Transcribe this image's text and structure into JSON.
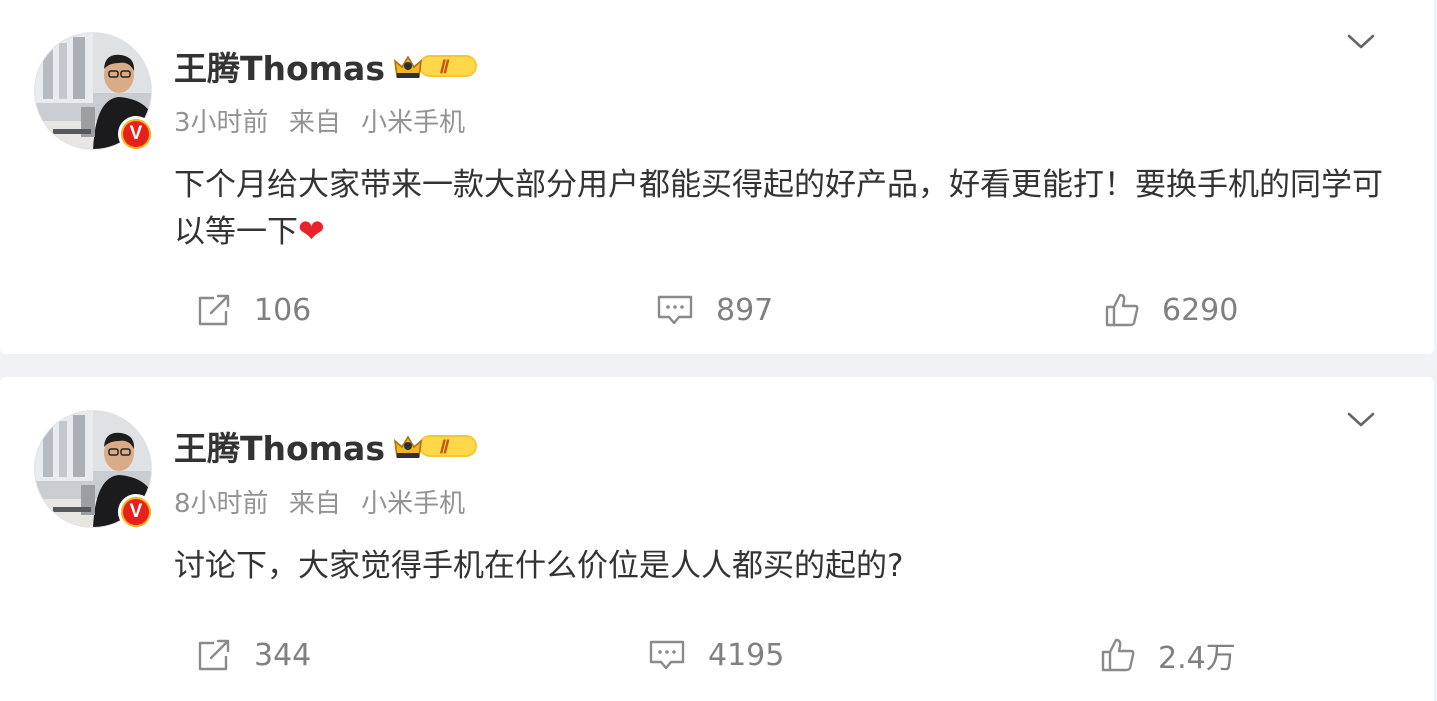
{
  "colors": {
    "background": "#f1f2f5",
    "card": "#ffffff",
    "name_text": "#333333",
    "meta_text": "#939393",
    "action_text": "#808080",
    "verified_badge_red": "#e8201c",
    "verified_badge_ring": "#f6b21b"
  },
  "posts": [
    {
      "author": "王腾Thomas",
      "verified_badge": "V",
      "member_badge_level": "Ⅱ",
      "time": "3小时前",
      "source_prefix": "来自",
      "source": "小米手机",
      "text": "下个月给大家带来一款大部分用户都能买得起的好产品，好看更能打！要换手机的同学可以等一下",
      "emoji": "❤",
      "reposts": "106",
      "comments": "897",
      "likes": "6290",
      "icons": [
        "more-chevron-icon",
        "repost-icon",
        "comment-icon",
        "like-icon"
      ]
    },
    {
      "author": "王腾Thomas",
      "verified_badge": "V",
      "member_badge_level": "Ⅱ",
      "time": "8小时前",
      "source_prefix": "来自",
      "source": "小米手机",
      "text": "讨论下，大家觉得手机在什么价位是人人都买的起的?",
      "reposts": "344",
      "comments": "4195",
      "likes": "2.4万",
      "icons": [
        "more-chevron-icon",
        "repost-icon",
        "comment-icon",
        "like-icon"
      ]
    }
  ]
}
